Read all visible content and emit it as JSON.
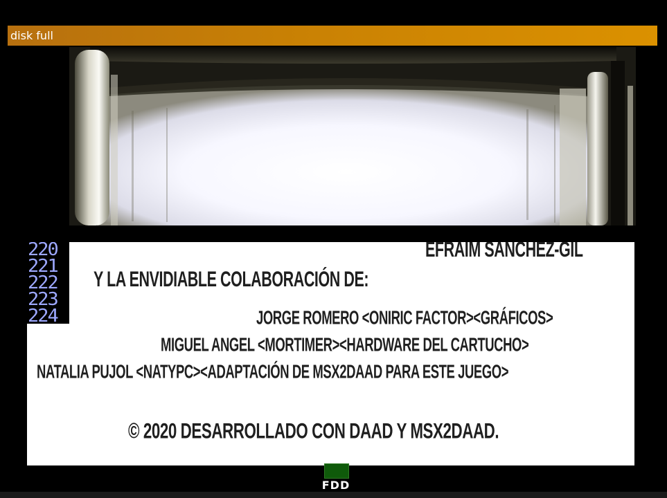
{
  "notice": {
    "text": "disk full"
  },
  "text_window": {
    "cut_line": "EFRAIM SANCHEZ-GIL",
    "heading": "Y LA ENVIDIABLE COLABORACIÓN DE:",
    "credits": [
      "JORGE ROMERO <ONIRIC FACTOR><GRÁFICOS>",
      "MIGUEL ANGEL <MORTIMER><HARDWARE DEL CARTUCHO>",
      "NATALIA PUJOL <NATYPC><ADAPTACIÓN DE MSX2DAAD PARA ESTE JUEGO>"
    ],
    "copyright": "© 2020 DESARROLLADO CON DAAD Y MSX2DAAD."
  },
  "line_counter": [
    "220",
    "221",
    "222",
    "223",
    "224"
  ],
  "status": {
    "drive_label": "FDD"
  },
  "colors": {
    "notice_bar": "#d08a00",
    "line_counter_text": "#9da8ff",
    "fdd_led": "#0f5a0a"
  }
}
